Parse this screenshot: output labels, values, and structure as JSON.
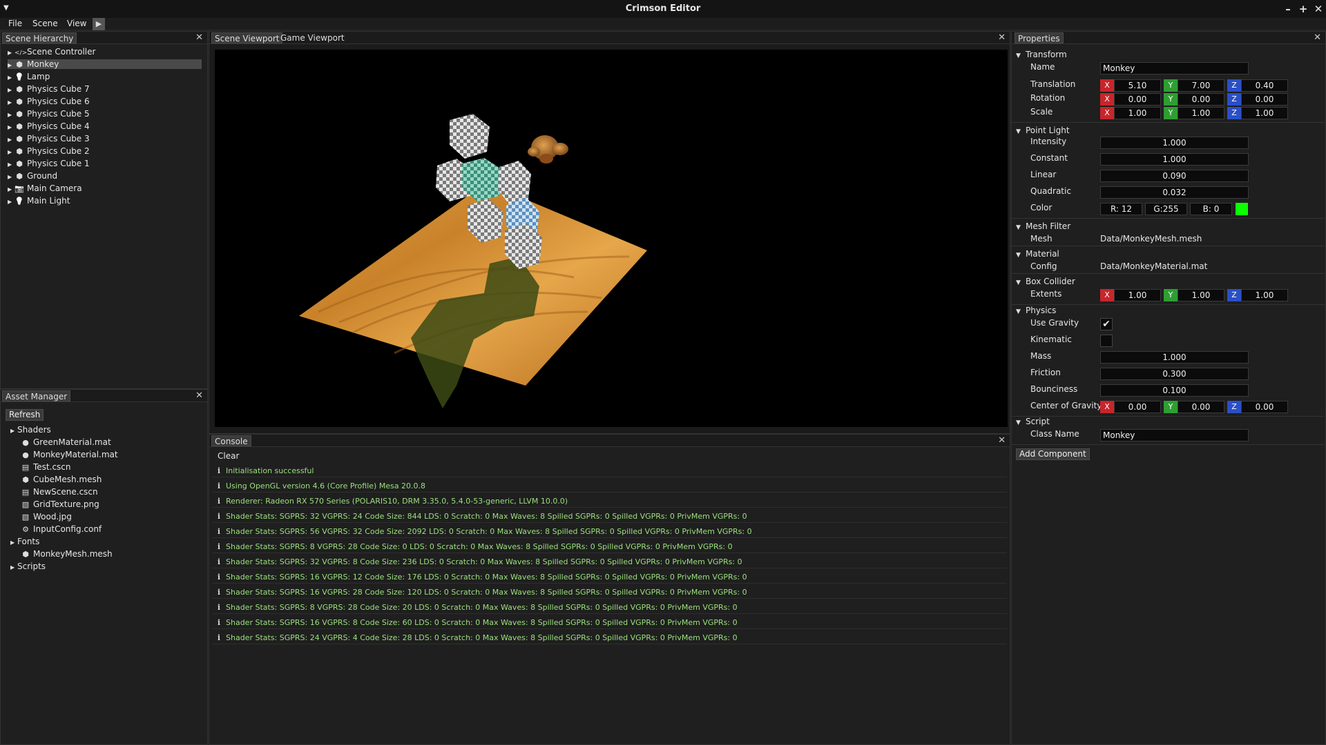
{
  "window": {
    "title": "Crimson Editor"
  },
  "menu": {
    "items": [
      "File",
      "Scene",
      "View"
    ]
  },
  "hierarchy": {
    "tab": "Scene Hierarchy",
    "items": [
      {
        "label": "Scene Controller",
        "icon": "code-icon"
      },
      {
        "label": "Monkey",
        "icon": "cube-icon",
        "selected": true
      },
      {
        "label": "Lamp",
        "icon": "lightbulb-icon"
      },
      {
        "label": "Physics Cube 7",
        "icon": "cube-icon"
      },
      {
        "label": "Physics Cube 6",
        "icon": "cube-icon"
      },
      {
        "label": "Physics Cube 5",
        "icon": "cube-icon"
      },
      {
        "label": "Physics Cube 4",
        "icon": "cube-icon"
      },
      {
        "label": "Physics Cube 3",
        "icon": "cube-icon"
      },
      {
        "label": "Physics Cube 2",
        "icon": "cube-icon"
      },
      {
        "label": "Physics Cube 1",
        "icon": "cube-icon"
      },
      {
        "label": "Ground",
        "icon": "cube-icon"
      },
      {
        "label": "Main Camera",
        "icon": "camera-icon"
      },
      {
        "label": "Main Light",
        "icon": "lightbulb-icon"
      }
    ]
  },
  "assets": {
    "tab": "Asset Manager",
    "refresh": "Refresh",
    "items": [
      {
        "label": "Shaders",
        "folder": true
      },
      {
        "label": "GreenMaterial.mat",
        "icon": "material-icon"
      },
      {
        "label": "MonkeyMaterial.mat",
        "icon": "material-icon"
      },
      {
        "label": "Test.cscn",
        "icon": "scene-file-icon"
      },
      {
        "label": "CubeMesh.mesh",
        "icon": "cube-icon"
      },
      {
        "label": "NewScene.cscn",
        "icon": "scene-file-icon"
      },
      {
        "label": "GridTexture.png",
        "icon": "image-icon"
      },
      {
        "label": "Wood.jpg",
        "icon": "image-icon"
      },
      {
        "label": "InputConfig.conf",
        "icon": "gear-icon"
      },
      {
        "label": "Fonts",
        "folder": true
      },
      {
        "label": "MonkeyMesh.mesh",
        "icon": "cube-icon"
      },
      {
        "label": "Scripts",
        "folder": true
      }
    ]
  },
  "viewport": {
    "tabs": [
      "Scene Viewport",
      "Game Viewport"
    ]
  },
  "console": {
    "tab": "Console",
    "clear": "Clear",
    "logs": [
      "Initialisation successful",
      "Using OpenGL version 4.6 (Core Profile) Mesa 20.0.8",
      "Renderer: Radeon RX 570 Series (POLARIS10, DRM 3.35.0, 5.4.0-53-generic, LLVM 10.0.0)",
      "Shader Stats: SGPRS: 32 VGPRS: 24 Code Size: 844 LDS: 0 Scratch: 0 Max Waves: 8 Spilled SGPRs: 0 Spilled VGPRs: 0 PrivMem VGPRs: 0",
      "Shader Stats: SGPRS: 56 VGPRS: 32 Code Size: 2092 LDS: 0 Scratch: 0 Max Waves: 8 Spilled SGPRs: 0 Spilled VGPRs: 0 PrivMem VGPRs: 0",
      "Shader Stats: SGPRS: 8 VGPRS: 28 Code Size: 0 LDS: 0 Scratch: 0 Max Waves: 8 Spilled SGPRs: 0 Spilled VGPRs: 0 PrivMem VGPRs: 0",
      "Shader Stats: SGPRS: 32 VGPRS: 8 Code Size: 236 LDS: 0 Scratch: 0 Max Waves: 8 Spilled SGPRs: 0 Spilled VGPRs: 0 PrivMem VGPRs: 0",
      "Shader Stats: SGPRS: 16 VGPRS: 12 Code Size: 176 LDS: 0 Scratch: 0 Max Waves: 8 Spilled SGPRs: 0 Spilled VGPRs: 0 PrivMem VGPRs: 0",
      "Shader Stats: SGPRS: 16 VGPRS: 28 Code Size: 120 LDS: 0 Scratch: 0 Max Waves: 8 Spilled SGPRs: 0 Spilled VGPRs: 0 PrivMem VGPRs: 0",
      "Shader Stats: SGPRS: 8 VGPRS: 28 Code Size: 20 LDS: 0 Scratch: 0 Max Waves: 8 Spilled SGPRs: 0 Spilled VGPRs: 0 PrivMem VGPRs: 0",
      "Shader Stats: SGPRS: 16 VGPRS: 8 Code Size: 60 LDS: 0 Scratch: 0 Max Waves: 8 Spilled SGPRs: 0 Spilled VGPRs: 0 PrivMem VGPRs: 0",
      "Shader Stats: SGPRS: 24 VGPRS: 4 Code Size: 28 LDS: 0 Scratch: 0 Max Waves: 8 Spilled SGPRs: 0 Spilled VGPRs: 0 PrivMem VGPRs: 0"
    ]
  },
  "properties": {
    "tab": "Properties",
    "transform": {
      "header": "Transform",
      "name_label": "Name",
      "name": "Monkey",
      "translation_label": "Translation",
      "translation": [
        "5.10",
        "7.00",
        "0.40"
      ],
      "rotation_label": "Rotation",
      "rotation": [
        "0.00",
        "0.00",
        "0.00"
      ],
      "scale_label": "Scale",
      "scale": [
        "1.00",
        "1.00",
        "1.00"
      ]
    },
    "point_light": {
      "header": "Point Light",
      "intensity_label": "Intensity",
      "intensity": "1.000",
      "constant_label": "Constant",
      "constant": "1.000",
      "linear_label": "Linear",
      "linear": "0.090",
      "quadratic_label": "Quadratic",
      "quadratic": "0.032",
      "color_label": "Color",
      "r": "R: 12",
      "g": "G:255",
      "b": "B:  0",
      "swatch": "#0cff00"
    },
    "mesh_filter": {
      "header": "Mesh Filter",
      "mesh_label": "Mesh",
      "mesh": "Data/MonkeyMesh.mesh"
    },
    "material": {
      "header": "Material",
      "config_label": "Config",
      "config": "Data/MonkeyMaterial.mat"
    },
    "box_collider": {
      "header": "Box Collider",
      "extents_label": "Extents",
      "extents": [
        "1.00",
        "1.00",
        "1.00"
      ]
    },
    "physics": {
      "header": "Physics",
      "use_gravity_label": "Use Gravity",
      "use_gravity": true,
      "kinematic_label": "Kinematic",
      "kinematic": false,
      "mass_label": "Mass",
      "mass": "1.000",
      "friction_label": "Friction",
      "friction": "0.300",
      "bounciness_label": "Bounciness",
      "bounciness": "0.100",
      "cog_label": "Center of Gravity",
      "cog": [
        "0.00",
        "0.00",
        "0.00"
      ]
    },
    "script": {
      "header": "Script",
      "class_label": "Class Name",
      "class_name": "Monkey"
    },
    "add_component": "Add Component",
    "axes": [
      "X",
      "Y",
      "Z"
    ]
  },
  "colors": {
    "axis_x": "#c8252b",
    "axis_y": "#2e9e32",
    "axis_z": "#2a4fc7",
    "log_text": "#9be07d"
  }
}
